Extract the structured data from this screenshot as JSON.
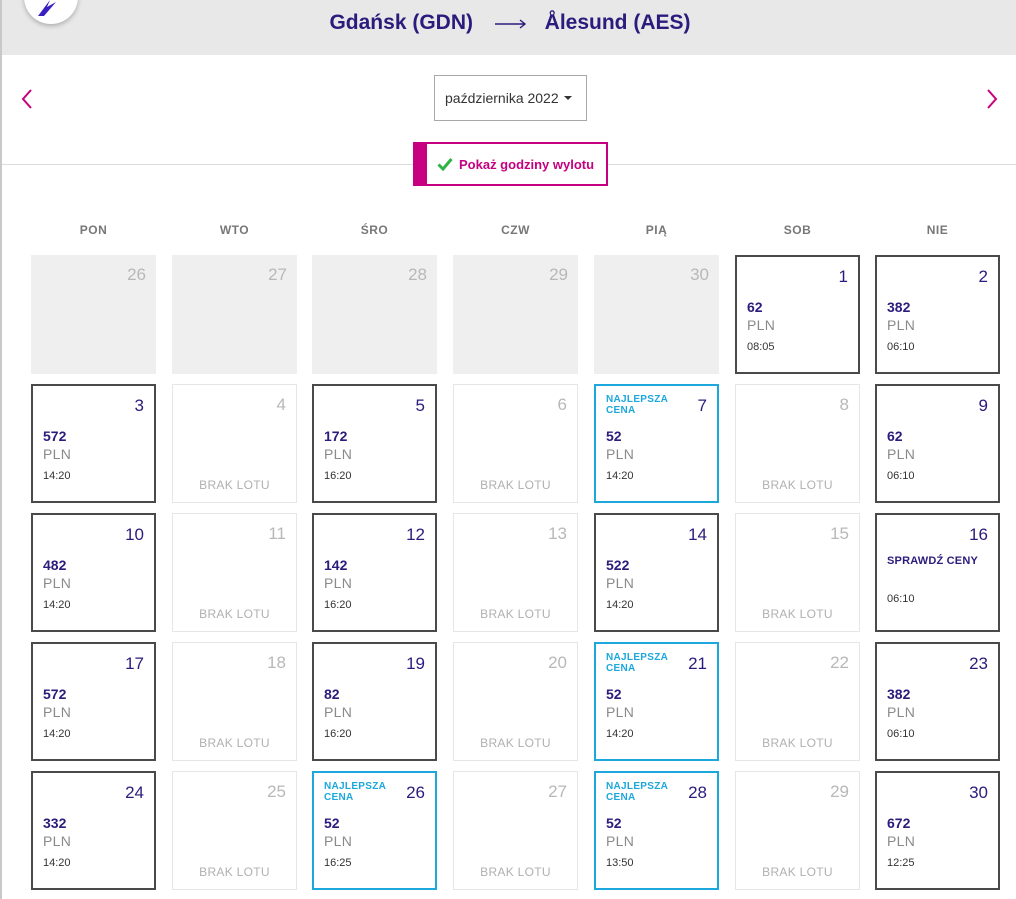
{
  "header": {
    "origin": "Gdańsk (GDN)",
    "destination": "Ålesund (AES)"
  },
  "month_select": {
    "value": "października 2022"
  },
  "toggle": {
    "label": "Pokaż godziny wylotu",
    "checked": true
  },
  "weekdays": [
    "PON",
    "WTO",
    "ŚRO",
    "CZW",
    "PIĄ",
    "SOB",
    "NIE"
  ],
  "labels": {
    "currency": "PLN",
    "no_flight": "BRAK LOTU",
    "best_price": "NAJLEPSZA CENA",
    "check_prices": "SPRAWDŹ CENY"
  },
  "colors": {
    "brand_navy": "#2b1b7c",
    "accent_magenta": "#c6007e",
    "best_price_blue": "#1ca8dd"
  },
  "days": [
    {
      "day": "26",
      "status": "past"
    },
    {
      "day": "27",
      "status": "past"
    },
    {
      "day": "28",
      "status": "past"
    },
    {
      "day": "29",
      "status": "past"
    },
    {
      "day": "30",
      "status": "past"
    },
    {
      "day": "1",
      "status": "available",
      "price": "62",
      "time": "08:05"
    },
    {
      "day": "2",
      "status": "available",
      "price": "382",
      "time": "06:10"
    },
    {
      "day": "3",
      "status": "available",
      "price": "572",
      "time": "14:20"
    },
    {
      "day": "4",
      "status": "no_flight"
    },
    {
      "day": "5",
      "status": "available",
      "price": "172",
      "time": "16:20"
    },
    {
      "day": "6",
      "status": "no_flight"
    },
    {
      "day": "7",
      "status": "best",
      "price": "52",
      "time": "14:20"
    },
    {
      "day": "8",
      "status": "no_flight"
    },
    {
      "day": "9",
      "status": "available",
      "price": "62",
      "time": "06:10"
    },
    {
      "day": "10",
      "status": "available",
      "price": "482",
      "time": "14:20"
    },
    {
      "day": "11",
      "status": "no_flight"
    },
    {
      "day": "12",
      "status": "available",
      "price": "142",
      "time": "16:20"
    },
    {
      "day": "13",
      "status": "no_flight"
    },
    {
      "day": "14",
      "status": "available",
      "price": "522",
      "time": "14:20"
    },
    {
      "day": "15",
      "status": "no_flight"
    },
    {
      "day": "16",
      "status": "check",
      "time": "06:10"
    },
    {
      "day": "17",
      "status": "available",
      "price": "572",
      "time": "14:20"
    },
    {
      "day": "18",
      "status": "no_flight"
    },
    {
      "day": "19",
      "status": "available",
      "price": "82",
      "time": "16:20"
    },
    {
      "day": "20",
      "status": "no_flight"
    },
    {
      "day": "21",
      "status": "best",
      "price": "52",
      "time": "14:20"
    },
    {
      "day": "22",
      "status": "no_flight"
    },
    {
      "day": "23",
      "status": "available",
      "price": "382",
      "time": "06:10"
    },
    {
      "day": "24",
      "status": "available",
      "price": "332",
      "time": "14:20"
    },
    {
      "day": "25",
      "status": "no_flight"
    },
    {
      "day": "26",
      "status": "best",
      "price": "52",
      "time": "16:25"
    },
    {
      "day": "27",
      "status": "no_flight"
    },
    {
      "day": "28",
      "status": "best",
      "price": "52",
      "time": "13:50"
    },
    {
      "day": "29",
      "status": "no_flight"
    },
    {
      "day": "30",
      "status": "available",
      "price": "672",
      "time": "12:25"
    }
  ]
}
